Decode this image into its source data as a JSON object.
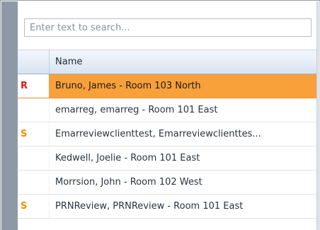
{
  "search": {
    "placeholder": "Enter text to search...",
    "value": ""
  },
  "table": {
    "columns": {
      "flag": "",
      "name": "Name"
    },
    "rows": [
      {
        "flag": "R",
        "name": "Bruno, James - Room 103 North",
        "selected": true
      },
      {
        "flag": "",
        "name": "emarreg, emarreg - Room 101 East",
        "selected": false
      },
      {
        "flag": "S",
        "name": "Emarreviewclienttest, Emarreviewclienttes...",
        "selected": false
      },
      {
        "flag": "",
        "name": "Kedwell, Joelie - Room 101 East",
        "selected": false
      },
      {
        "flag": "",
        "name": "Morrsion, John - Room 102 West",
        "selected": false
      },
      {
        "flag": "S",
        "name": "PRNReview, PRNReview - Room 101 East",
        "selected": false
      }
    ]
  },
  "colors": {
    "selected_row": "#f8a03a",
    "flag_r": "#e01919",
    "flag_s": "#f08f00",
    "left_rail": "#8f98a6"
  }
}
